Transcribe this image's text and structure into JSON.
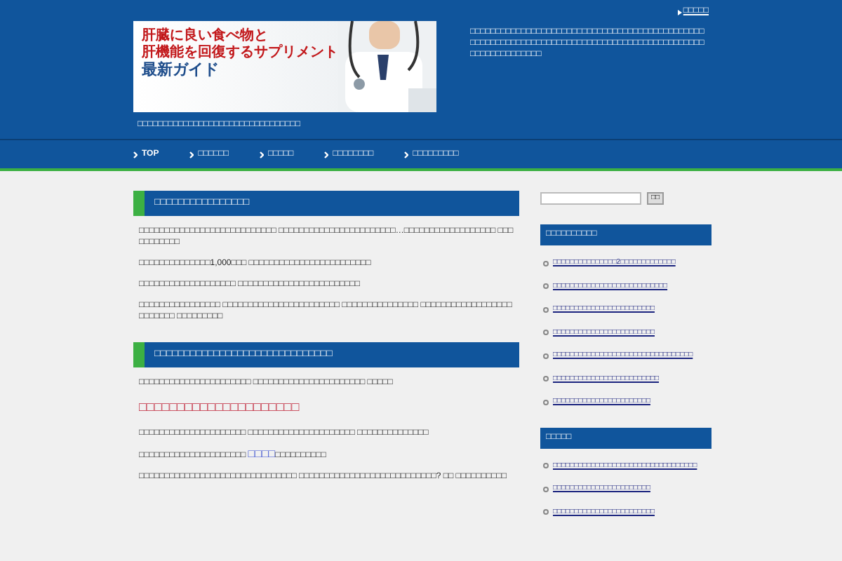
{
  "header": {
    "top_link": "□□□□□",
    "banner": {
      "lines": [
        "肝臓に良い食べ物と",
        "肝機能を回復するサプリメント",
        "最新ガイド"
      ]
    },
    "description": "□□□□□□□□□□□□□□□□□□□□□□□□□□□□□□□□□□□□□□□□□□□□□□□□□□□□□□□□□□□□□□□□□□□□□□□□□□□□□□□□□□□□□□□□□□□□□□□□□□□□□□□□□□",
    "tagline": "□□□□□□□□□□□□□□□□□□□□□□□□□□□□□□□□"
  },
  "nav": [
    {
      "label": "TOP"
    },
    {
      "label": "□□□□□□"
    },
    {
      "label": "□□□□□"
    },
    {
      "label": "□□□□□□□□"
    },
    {
      "label": "□□□□□□□□□"
    }
  ],
  "articles": [
    {
      "title": "□□□□□□□□□□□□□□□□",
      "paragraphs": [
        {
          "kind": "plain",
          "text": "□□□□□□□□□□□□□□□□□□□□□□□□□□□ □□□□□□□□□□□□□□□□□□□□□□□…□□□□□□□□□□□□□□□□□□ □□□□□□□□□□□"
        },
        {
          "kind": "plain",
          "text": "□□□□□□□□□□□□□□1,000□□□ □□□□□□□□□□□□□□□□□□□□□□□□"
        },
        {
          "kind": "plain",
          "text": "□□□□□□□□□□□□□□□□□□□ □□□□□□□□□□□□□□□□□□□□□□□□"
        },
        {
          "kind": "plain",
          "text": "□□□□□□□□□□□□□□□□ □□□□□□□□□□□□□□□□□□□□□□□ □□□□□□□□□□□□□□□ □□□□□□□□□□□□□□□□□□ □□□□□□□ □□□□□□□□□"
        }
      ]
    },
    {
      "title": "□□□□□□□□□□□□□□□□□□□□□□□□□□□□□□",
      "paragraphs": [
        {
          "kind": "plain",
          "text": "□□□□□□□□□□□□□□□□□□□□□□ □□□□□□□□□□□□□□□□□□□□□□ □□□□□"
        },
        {
          "kind": "heading",
          "text": "□□□□□□□□□□□□□□□□□□□□□"
        },
        {
          "kind": "plain",
          "text": "□□□□□□□□□□□□□□□□□□□□□ □□□□□□□□□□□□□□□□□□□□□ □□□□□□□□□□□□□□"
        },
        {
          "kind": "link",
          "before": "□□□□□□□□□□□□□□□□□□□□□ ",
          "link": "□□□□",
          "after": "□□□□□□□□□□"
        },
        {
          "kind": "plain",
          "text": "□□□□□□□□□□□□□□□□□□□□□□□□□□□□□□□ □□□□□□□□□□□□□□□□□□□□□□□□□□□? □□ □□□□□□□□□□"
        }
      ]
    }
  ],
  "sidebar": {
    "search_button": "□□",
    "widgets": [
      {
        "title": "□□□□□□□□□□",
        "items": [
          "□□□□□□□□□□□□□□□2□□□□□□□□□□□□□",
          "□□□□□□□□□□□□□□□□□□□□□□□□□□□",
          "□□□□□□□□□□□□□□□□□□□□□□□□",
          "□□□□□□□□□□□□□□□□□□□□□□□□",
          "□□□□□□□□□□□□□□□□□□□□□□□□□□□□□□□□□",
          "□□□□□□□□□□□□□□□□□□□□□□□□□",
          "□□□□□□□□□□□□□□□□□□□□□□□"
        ]
      },
      {
        "title": "□□□□□",
        "items": [
          "□□□□□□□□□□□□□□□□□□□□□□□□□□□□□□□□□□",
          "□□□□□□□□□□□□□□□□□□□□□□□",
          "□□□□□□□□□□□□□□□□□□□□□□□□"
        ]
      }
    ]
  }
}
